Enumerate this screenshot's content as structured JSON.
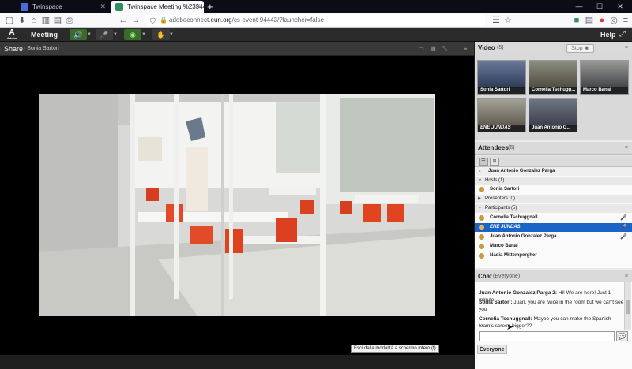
{
  "browser": {
    "tabs": [
      {
        "title": "Twinspace",
        "active": false,
        "favicon_color": "#4b6bd6"
      },
      {
        "title": "Twinspace Meeting %2394443",
        "active": true,
        "favicon_color": "#2f8f5f"
      }
    ],
    "new_tab": "+",
    "url": {
      "prefix": "adobeconnect.",
      "host": "eun.org",
      "path": "/cs-event-94443/?launcher=false"
    }
  },
  "connect_bar": {
    "logo": "Adobe",
    "meeting_menu": "Meeting",
    "help": "Help",
    "buttons": [
      {
        "name": "speaker",
        "glyph": "🔊"
      },
      {
        "name": "microphone",
        "glyph": "🎤"
      },
      {
        "name": "webcam",
        "glyph": "◉"
      },
      {
        "name": "raise-hand",
        "glyph": "✋"
      }
    ]
  },
  "share_pod": {
    "title": "Share",
    "presenter": "· Sonia Sartori"
  },
  "tooltip": "Esci dalla modalità a schermo intero (f)",
  "video_pod": {
    "title": "Video",
    "count": "(5)",
    "stop_label": "Stop",
    "tiles": [
      {
        "name": "Sonia Sartori"
      },
      {
        "name": "Cornelia Tschugg..."
      },
      {
        "name": "Marco Banal"
      },
      {
        "name": "ENE JUNDAS"
      },
      {
        "name": "Juan Antonio G..."
      }
    ]
  },
  "attendees_pod": {
    "title": "Attendees",
    "count": "(6)",
    "me": "Juan Antonio Gonzalez Parga",
    "groups": [
      {
        "label": "Hosts (1)",
        "members": [
          "Sonia Sartori"
        ]
      },
      {
        "label": "Presenters (0)",
        "members": []
      },
      {
        "label": "Participants (5)",
        "members": [
          "Cornelia Tschuggnall",
          "ENE JUNDAS",
          "Juan Antonio Gonzalez Parga",
          "Marco Banal",
          "Nadia Mittempergher"
        ]
      }
    ],
    "selected": "ENE JUNDAS"
  },
  "chat_pod": {
    "title": "Chat",
    "scope": "(Everyone)",
    "messages": [
      {
        "sender": "Juan Antonio Gonzalez Parga 2:",
        "text": " Hi! We are here! Just 1 minute"
      },
      {
        "sender": "Sonia Sartori:",
        "text": " Juan, you are twice in the room but we can't see you"
      },
      {
        "sender": "Cornelia Tschuggnall:",
        "text": " Maybe you can make the Spanish team's screen bigger??"
      }
    ],
    "recipient": "Everyone"
  },
  "colors": {
    "accent_selected": "#1b64c7",
    "connect_bar": "#2b2b2b",
    "share_bg": "#000000"
  }
}
